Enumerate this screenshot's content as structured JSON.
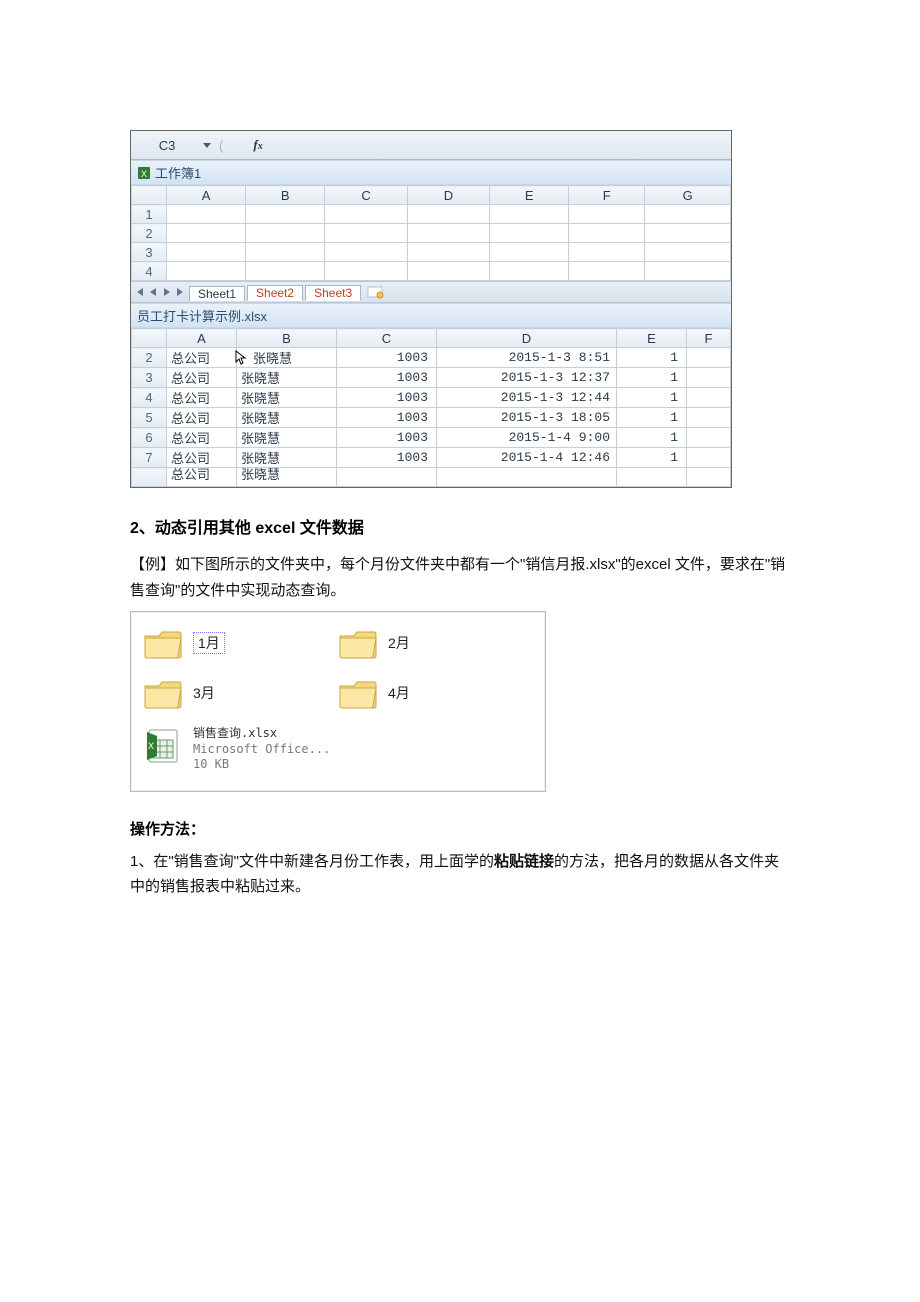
{
  "formula_bar": {
    "cell_ref": "C3",
    "fx_label": "fx"
  },
  "workbook1": {
    "title": "工作簿1",
    "cols": [
      "A",
      "B",
      "C",
      "D",
      "E",
      "F",
      "G"
    ],
    "rows": [
      "1",
      "2",
      "3",
      "4"
    ],
    "tabs": {
      "s1": "Sheet1",
      "s2": "Sheet2",
      "s3": "Sheet3"
    }
  },
  "workbook2": {
    "title": "员工打卡计算示例.xlsx",
    "cols": [
      "A",
      "B",
      "C",
      "D",
      "E",
      "F"
    ],
    "rows": [
      {
        "n": "2",
        "a": "总公司",
        "b": "张晓慧",
        "c": "1003",
        "d": "2015-1-3 8:51",
        "e": "1"
      },
      {
        "n": "3",
        "a": "总公司",
        "b": "张晓慧",
        "c": "1003",
        "d": "2015-1-3 12:37",
        "e": "1"
      },
      {
        "n": "4",
        "a": "总公司",
        "b": "张晓慧",
        "c": "1003",
        "d": "2015-1-3 12:44",
        "e": "1"
      },
      {
        "n": "5",
        "a": "总公司",
        "b": "张晓慧",
        "c": "1003",
        "d": "2015-1-3 18:05",
        "e": "1"
      },
      {
        "n": "6",
        "a": "总公司",
        "b": "张晓慧",
        "c": "1003",
        "d": "2015-1-4 9:00",
        "e": "1"
      },
      {
        "n": "7",
        "a": "总公司",
        "b": "张晓慧",
        "c": "1003",
        "d": "2015-1-4 12:46",
        "e": "1"
      }
    ],
    "clip": {
      "a": "总公司",
      "b": "张晓慧"
    }
  },
  "section_heading": "2、动态引用其他 excel 文件数据",
  "example_p1": "【例】如下图所示的文件夹中，每个月份文件夹中都有一个\"销信月报.xlsx\"的excel 文件，要求在\"销售查询\"的文件中实现动态查询。",
  "folders": {
    "m1": "1月",
    "m2": "2月",
    "m3": "3月",
    "m4": "4月",
    "file_name": "销售查询.xlsx",
    "file_app": "Microsoft Office...",
    "file_size": "10 KB"
  },
  "method_heading": "操作方法：",
  "step1_pre": "1、在\"销售查询\"文件中新建各月份工作表，用上面学的",
  "step1_bold": "粘贴链接",
  "step1_post": "的方法，把各月的数据从各文件夹中的销售报表中粘贴过来。"
}
